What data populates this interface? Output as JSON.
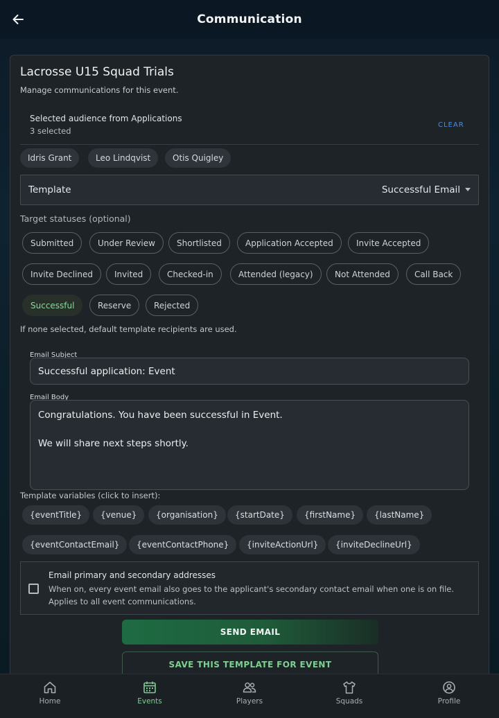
{
  "header": {
    "title": "Communication"
  },
  "event": {
    "title": "Lacrosse U15 Squad Trials",
    "description": "Manage communications for this event."
  },
  "audience": {
    "label": "Selected audience from Applications",
    "count": "3 selected",
    "clear_label": "CLEAR",
    "recipients": [
      "Idris Grant",
      "Leo Lindqvist",
      "Otis Quigley"
    ]
  },
  "template": {
    "label": "Template",
    "value": "Successful Email"
  },
  "target_statuses": {
    "label": "Target statuses (optional)",
    "items": [
      "Submitted",
      "Under Review",
      "Shortlisted",
      "Application Accepted",
      "Invite Accepted",
      "Invite Declined",
      "Invited",
      "Checked-in",
      "Attended (legacy)",
      "Not Attended",
      "Call Back",
      "Successful",
      "Reserve",
      "Rejected"
    ],
    "selected": "Successful",
    "hint": "If none selected, default template recipients are used."
  },
  "email": {
    "subject_label": "Email Subject",
    "subject_value": "Successful application: Event",
    "body_label": "Email Body",
    "body_line1": "Congratulations. You have been successful in Event.",
    "body_line2": "We will share next steps shortly."
  },
  "variables": {
    "label": "Template variables (click to insert):",
    "items": [
      "{eventTitle}",
      "{venue}",
      "{organisation}",
      "{startDate}",
      "{firstName}",
      "{lastName}",
      "{eventContactEmail}",
      "{eventContactPhone}",
      "{inviteActionUrl}",
      "{inviteDeclineUrl}"
    ]
  },
  "secondary_email": {
    "title": "Email primary and secondary addresses",
    "desc_line1": "When on, every event email also goes to the applicant's secondary contact email when one is on file.",
    "desc_line2": "Applies to all event communications.",
    "checked": false
  },
  "actions": {
    "send_label": "SEND EMAIL",
    "save_label": "SAVE THIS TEMPLATE FOR EVENT"
  },
  "nav": {
    "items": [
      {
        "label": "Home",
        "icon": "home-icon"
      },
      {
        "label": "Events",
        "icon": "calendar-icon"
      },
      {
        "label": "Players",
        "icon": "players-icon"
      },
      {
        "label": "Squads",
        "icon": "shirt-icon"
      },
      {
        "label": "Profile",
        "icon": "profile-icon"
      }
    ],
    "active": "Events"
  },
  "colors": {
    "accent_green": "#7fcf92",
    "link_blue": "#4a8fe0",
    "card_bg": "#1e2327"
  }
}
